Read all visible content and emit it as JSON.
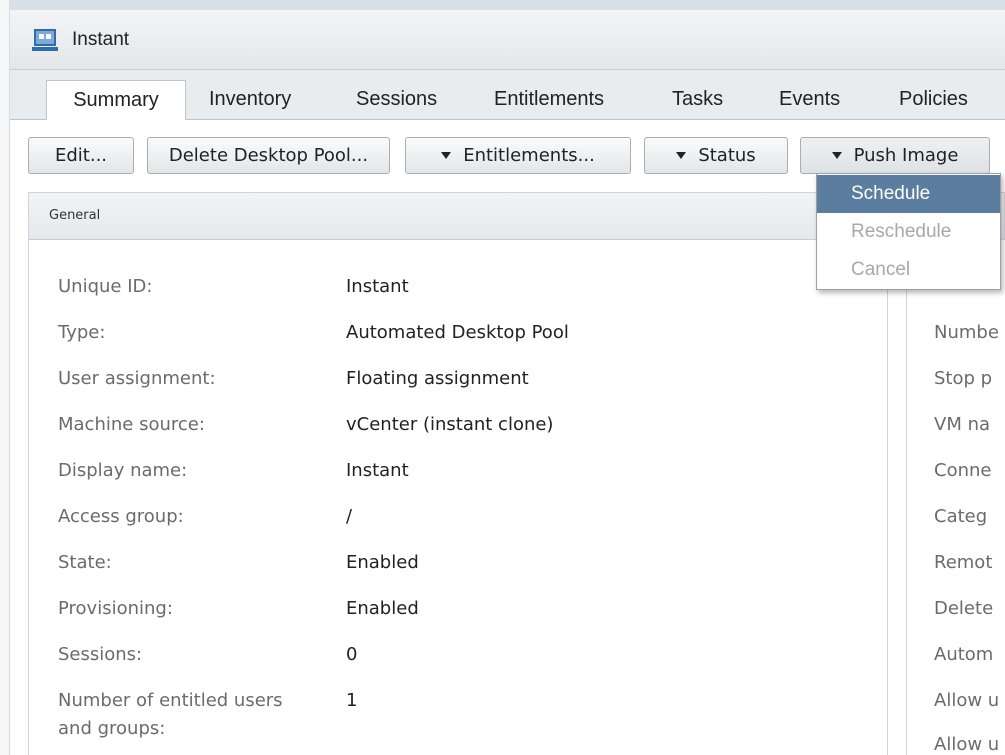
{
  "window": {
    "title": "Instant"
  },
  "tabs": [
    {
      "label": "Summary",
      "active": true
    },
    {
      "label": "Inventory"
    },
    {
      "label": "Sessions"
    },
    {
      "label": "Entitlements"
    },
    {
      "label": "Tasks"
    },
    {
      "label": "Events"
    },
    {
      "label": "Policies"
    }
  ],
  "toolbar": {
    "edit": "Edit...",
    "delete_pool": "Delete Desktop Pool...",
    "entitlements": "Entitlements...",
    "status": "Status",
    "push_image": "Push Image"
  },
  "push_image_menu": {
    "items": [
      {
        "label": "Schedule",
        "state": "highlighted"
      },
      {
        "label": "Reschedule",
        "state": "disabled"
      },
      {
        "label": "Cancel",
        "state": "disabled"
      }
    ]
  },
  "general": {
    "header": "General",
    "fields": [
      {
        "label": "Unique ID:",
        "value": "Instant"
      },
      {
        "label": "Type:",
        "value": "Automated Desktop Pool"
      },
      {
        "label": "User assignment:",
        "value": "Floating assignment"
      },
      {
        "label": "Machine source:",
        "value": "vCenter (instant clone)"
      },
      {
        "label": "Display name:",
        "value": "Instant"
      },
      {
        "label": "Access group:",
        "value": "/"
      },
      {
        "label": "State:",
        "value": "Enabled"
      },
      {
        "label": "Provisioning:",
        "value": "Enabled"
      },
      {
        "label": "Sessions:",
        "value": "0"
      },
      {
        "label_line1": "Number of entitled users",
        "label_line2": "and groups:",
        "value": "1"
      }
    ]
  },
  "right_panel": {
    "labels": [
      "Numbe",
      "Stop p",
      "VM na",
      "Conne",
      "Categ",
      "Remot",
      "Delete",
      "Autom",
      "Allow u",
      "Allow u"
    ]
  },
  "colors": {
    "menu_highlight": "#5b7d9f",
    "icon_blue": "#2f6cab"
  }
}
